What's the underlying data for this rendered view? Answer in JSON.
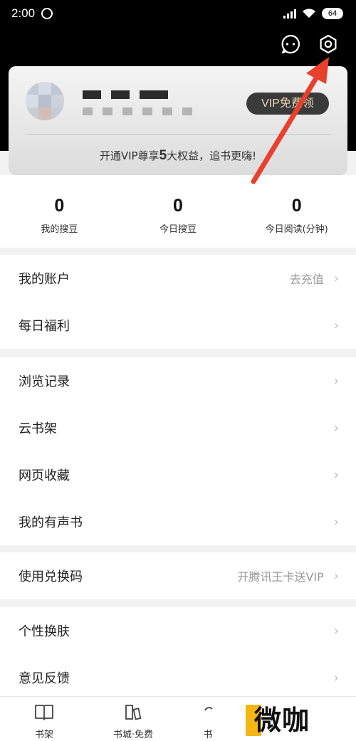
{
  "status_bar": {
    "time": "2:00",
    "battery": "64"
  },
  "card": {
    "vip_button": "VIP免费领",
    "promo_prefix": "开通VIP尊享",
    "promo_number": "5",
    "promo_suffix": "大权益，追书更嗨!"
  },
  "stats": [
    {
      "value": "0",
      "label": "我的搜豆"
    },
    {
      "value": "0",
      "label": "今日搜豆"
    },
    {
      "value": "0",
      "label": "今日阅读(分钟)"
    }
  ],
  "menu": {
    "account": {
      "label": "我的账户",
      "hint": "去充值"
    },
    "daily_welfare": {
      "label": "每日福利"
    },
    "history": {
      "label": "浏览记录"
    },
    "cloud_shelf": {
      "label": "云书架"
    },
    "bookmarks": {
      "label": "网页收藏"
    },
    "audiobooks": {
      "label": "我的有声书"
    },
    "redeem": {
      "label": "使用兑换码",
      "hint": "开腾讯王卡送VIP"
    },
    "skin": {
      "label": "个性换肤"
    },
    "feedback": {
      "label": "意见反馈"
    }
  },
  "tabbar": [
    {
      "label": "书架",
      "icon": "book-icon"
    },
    {
      "label": "书城·免费",
      "icon": "bookstore-icon"
    },
    {
      "label": "书",
      "icon": "discover-icon"
    }
  ],
  "watermark": "微咖",
  "annotation_color": "#e8402a"
}
